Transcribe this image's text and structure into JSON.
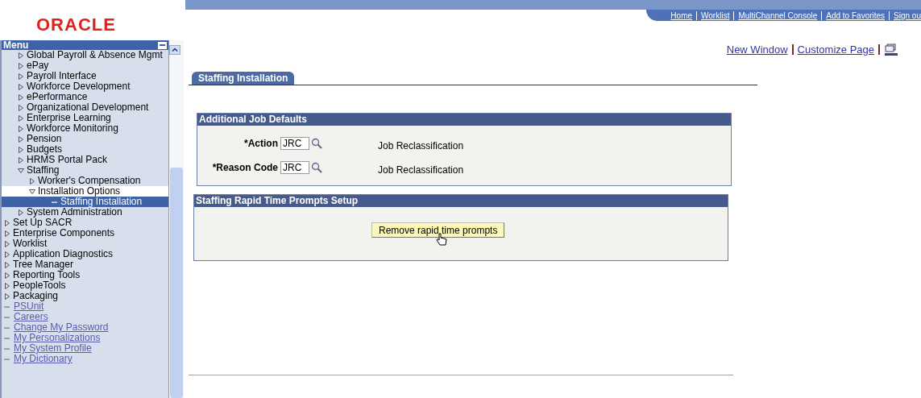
{
  "logo": "ORACLE",
  "nav_links": [
    "Home",
    "Worklist",
    "MultiChannel Console",
    "Add to Favorites",
    "Sign ou"
  ],
  "menu": {
    "title": "Menu",
    "open_branch": [
      {
        "label": "Global Payroll & Absence Mgmt",
        "expanded": false
      },
      {
        "label": "ePay",
        "expanded": false
      },
      {
        "label": "Payroll Interface",
        "expanded": false
      },
      {
        "label": "Workforce Development",
        "expanded": false
      },
      {
        "label": "ePerformance",
        "expanded": false
      },
      {
        "label": "Organizational Development",
        "expanded": false
      },
      {
        "label": "Enterprise Learning",
        "expanded": false
      },
      {
        "label": "Workforce Monitoring",
        "expanded": false
      },
      {
        "label": "Pension",
        "expanded": false
      },
      {
        "label": "Budgets",
        "expanded": false
      },
      {
        "label": "HRMS Portal Pack",
        "expanded": false
      },
      {
        "label": "Staffing",
        "expanded": true,
        "children": [
          {
            "label": "Worker's Compensation",
            "expanded": false,
            "in_path": false
          },
          {
            "label": "Installation Options",
            "expanded": true,
            "in_path": true,
            "children": [
              {
                "label": "Staffing Installation",
                "selected": true
              }
            ]
          }
        ]
      },
      {
        "label": "System Administration",
        "expanded": false
      }
    ],
    "items": [
      {
        "kind": "folder",
        "label": "Set Up SACR"
      },
      {
        "kind": "folder",
        "label": "Enterprise Components"
      },
      {
        "kind": "folder",
        "label": "Worklist"
      },
      {
        "kind": "folder",
        "label": "Application Diagnostics"
      },
      {
        "kind": "folder",
        "label": "Tree Manager"
      },
      {
        "kind": "folder",
        "label": "Reporting Tools"
      },
      {
        "kind": "folder",
        "label": "PeopleTools"
      },
      {
        "kind": "folder",
        "label": "Packaging"
      },
      {
        "kind": "link",
        "label": "PSUnit"
      },
      {
        "kind": "link",
        "label": "Careers"
      },
      {
        "kind": "link",
        "label": "Change My Password"
      },
      {
        "kind": "link",
        "label": "My Personalizations"
      },
      {
        "kind": "link",
        "label": "My System Profile"
      },
      {
        "kind": "link",
        "label": "My Dictionary"
      }
    ]
  },
  "page_links": [
    "New Window",
    "Customize Page"
  ],
  "tabs": [
    {
      "label": "Staffing Installation",
      "selected": true
    }
  ],
  "job_defaults": {
    "title": "Additional Job Defaults",
    "fields": [
      {
        "label": "*Action",
        "value": "JRC",
        "description": "Job Reclassification"
      },
      {
        "label": "*Reason Code",
        "value": "JRC",
        "description": "Job Reclassification"
      }
    ]
  },
  "rapid_time": {
    "title": "Staffing Rapid Time Prompts Setup",
    "button": "Remove rapid time prompts"
  }
}
